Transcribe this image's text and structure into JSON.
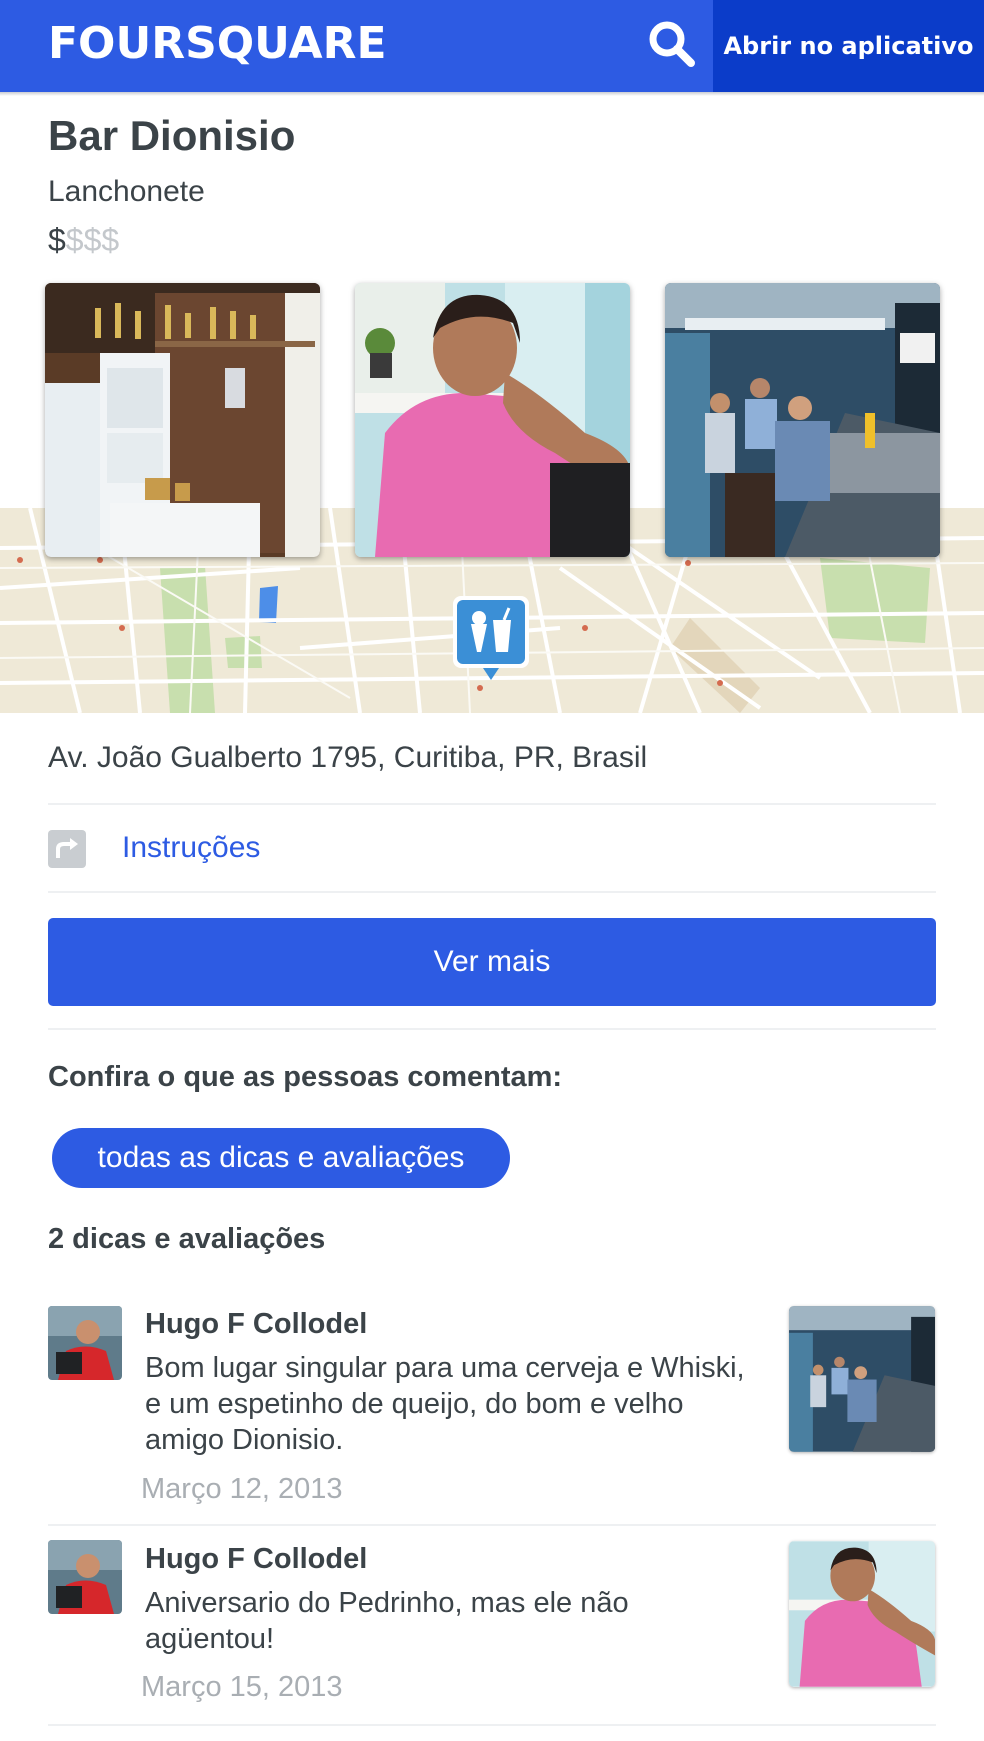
{
  "header": {
    "logo": "FOURSQUARE",
    "search_icon": "search-icon",
    "open_app_label": "Abrir no aplicativo"
  },
  "venue": {
    "name": "Bar Dionisio",
    "category": "Lanchonete",
    "price_active": "$",
    "price_inactive": "$$$",
    "address": "Av. João Gualberto 1795, Curitiba, PR, Brasil"
  },
  "photos": [
    "bar-shelves-photo",
    "man-in-pink-shirt-photo",
    "bar-counter-photo"
  ],
  "map": {
    "pin_icon": "food-drink-pin-icon"
  },
  "directions": {
    "icon": "turn-right-arrow-icon",
    "label": "Instruções"
  },
  "ver_mais_label": "Ver mais",
  "reviews": {
    "section_title": "Confira o que as pessoas comentam:",
    "all_tips_label": "todas as dicas e avaliações",
    "count_label": "2 dicas e avaliações",
    "tips": [
      {
        "author": "Hugo F Collodel",
        "text": "Bom lugar singular para uma cerveja e Whiski, e um espetinho de queijo, do bom e velho amigo Dionisio.",
        "date": "Março 12, 2013"
      },
      {
        "author": "Hugo F Collodel",
        "text": "Aniversario do Pedrinho, mas ele não agüentou!",
        "date": "Março 15, 2013"
      }
    ]
  },
  "colors": {
    "brand_blue": "#2d5be3",
    "dark_blue": "#0b3cc9",
    "text": "#3b4348",
    "muted": "#a9aeb3"
  }
}
